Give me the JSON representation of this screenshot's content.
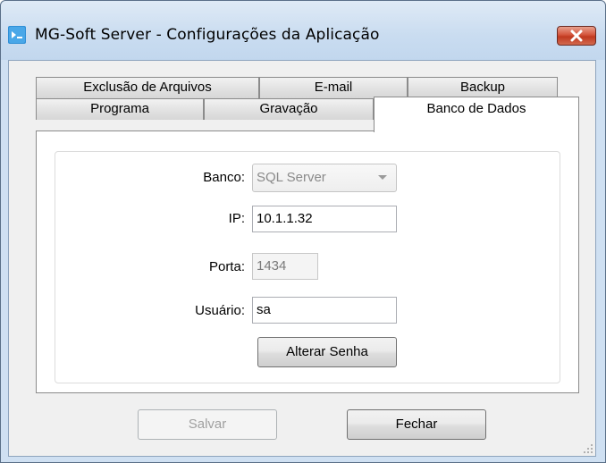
{
  "window": {
    "title": "MG-Soft Server - Configurações da Aplicação",
    "icon": "app-icon",
    "close_icon": "close-icon"
  },
  "tabs": {
    "row1": [
      {
        "label": "Exclusão de Arquivos"
      },
      {
        "label": "E-mail"
      },
      {
        "label": "Backup"
      }
    ],
    "row2": [
      {
        "label": "Programa"
      },
      {
        "label": "Gravação"
      },
      {
        "label": "Banco de Dados",
        "active": true
      }
    ]
  },
  "form": {
    "banco_label": "Banco:",
    "banco_value": "SQL Server",
    "ip_label": "IP:",
    "ip_value": "10.1.1.32",
    "porta_label": "Porta:",
    "porta_value": "1434",
    "usuario_label": "Usuário:",
    "usuario_value": "sa",
    "alterar_senha_label": "Alterar Senha"
  },
  "footer": {
    "salvar_label": "Salvar",
    "fechar_label": "Fechar"
  },
  "colors": {
    "titlebar": "#c9dcf0",
    "close_button": "#c0391f",
    "client_background": "#f0f0f0"
  }
}
